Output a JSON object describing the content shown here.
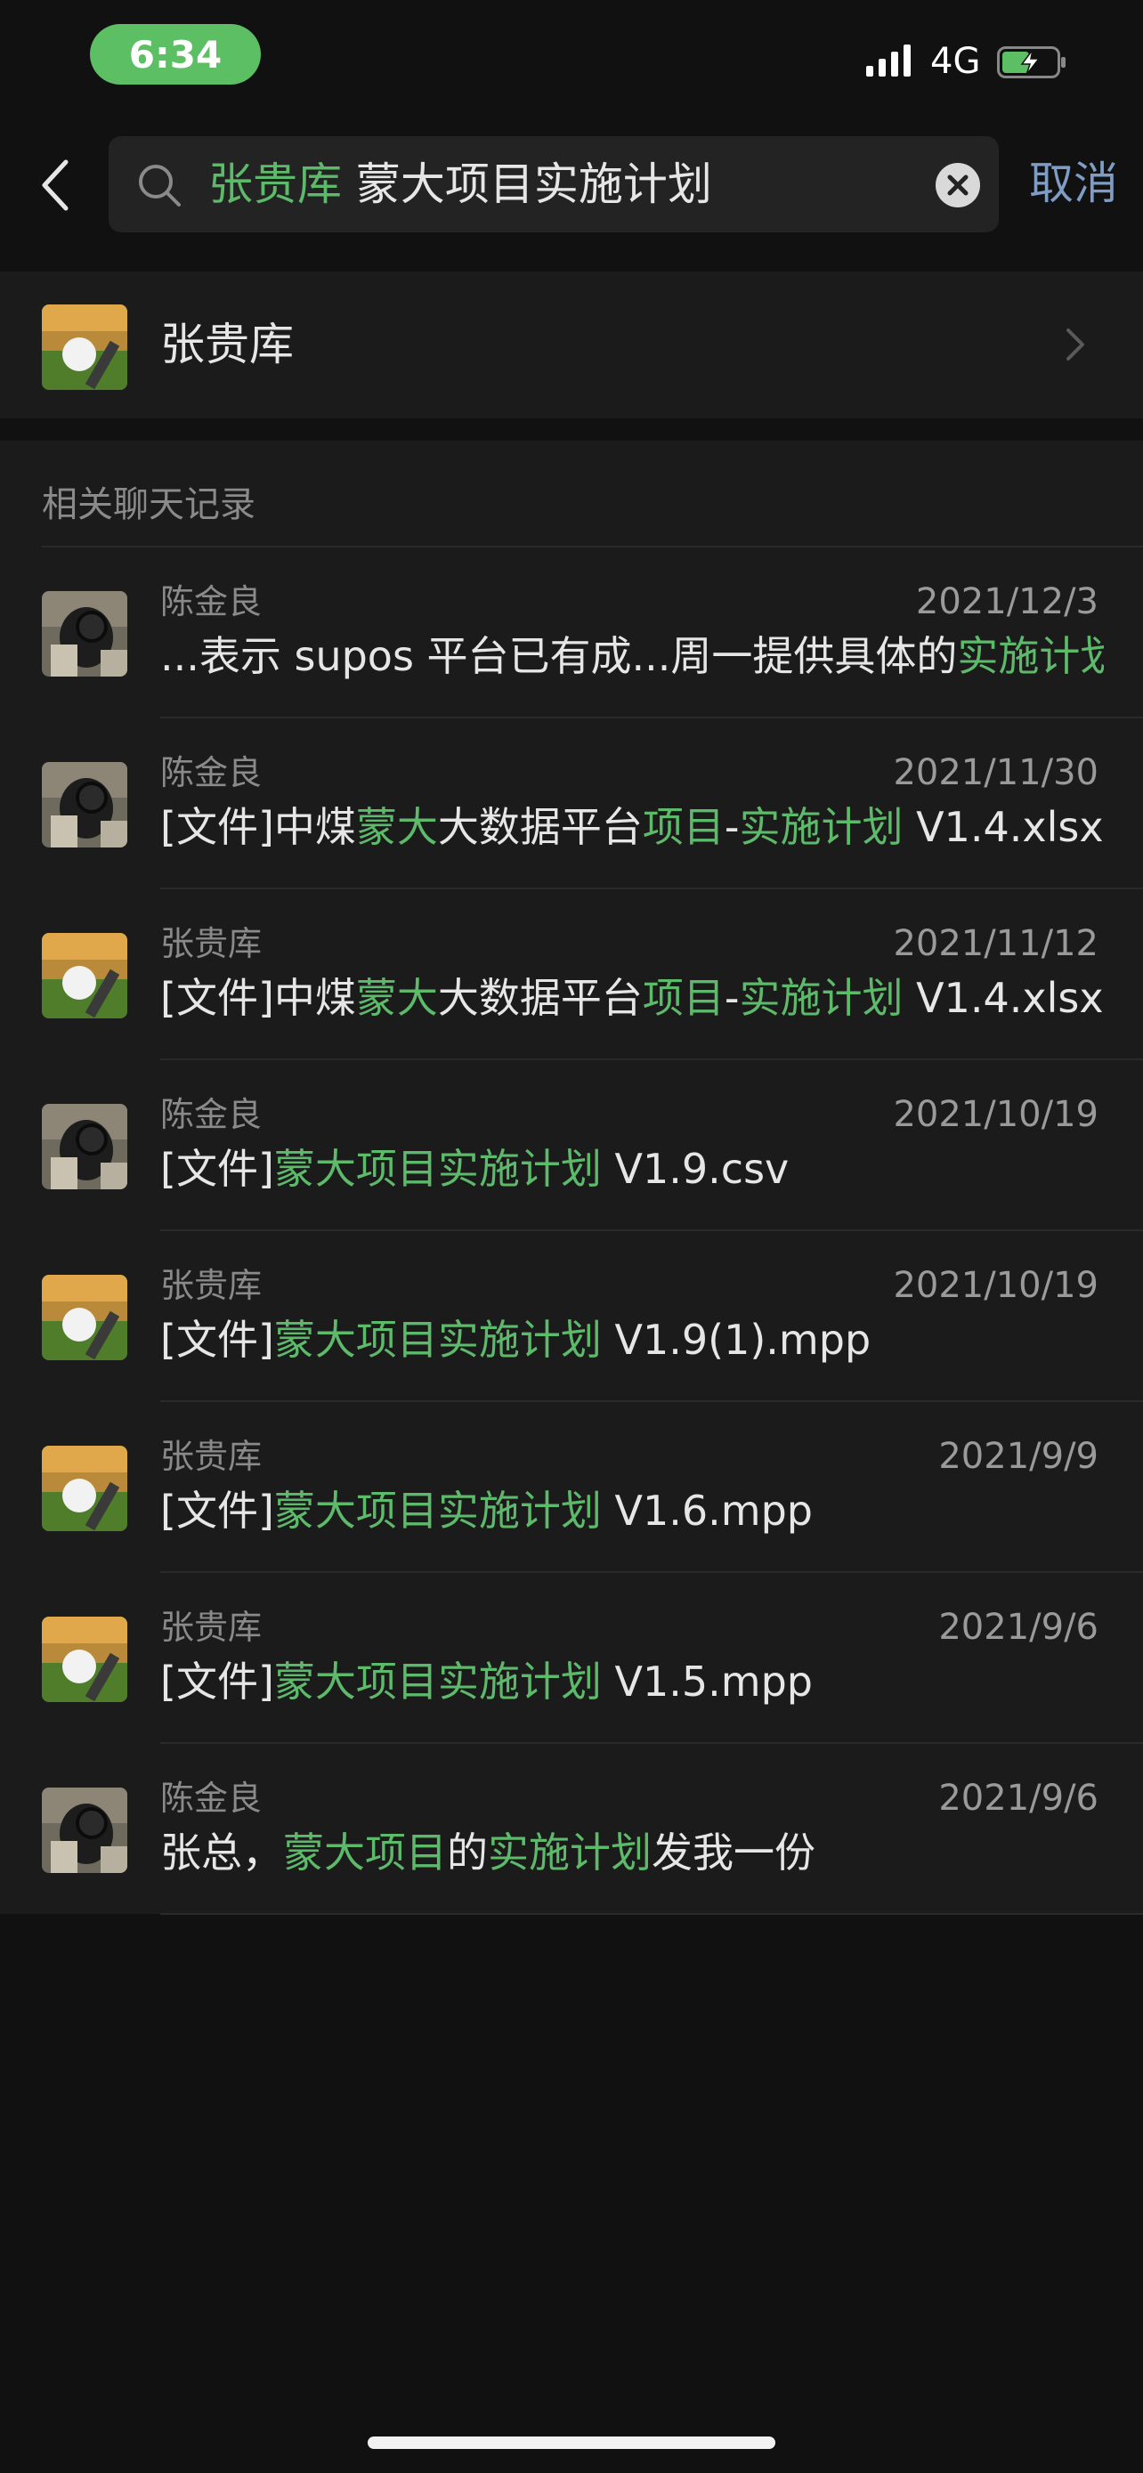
{
  "status_bar": {
    "time": "6:34",
    "network": "4G"
  },
  "search": {
    "query_highlight": "张贵库",
    "query_rest": "蒙大项目实施计划",
    "cancel_label": "取消"
  },
  "contact": {
    "name": "张贵库"
  },
  "related": {
    "title": "相关聊天记录",
    "messages": [
      {
        "sender": "陈金良",
        "date": "2021/12/3",
        "avatar": "camera-avatar",
        "parts": [
          {
            "text": "...表示 supos 平台已有成...周一提供具体的",
            "highlight": false
          },
          {
            "text": "实施计划",
            "highlight": true
          }
        ]
      },
      {
        "sender": "陈金良",
        "date": "2021/11/30",
        "avatar": "camera-avatar",
        "parts": [
          {
            "text": "[文件]中煤",
            "highlight": false
          },
          {
            "text": "蒙大",
            "highlight": true
          },
          {
            "text": "大数据平台",
            "highlight": false
          },
          {
            "text": "项目",
            "highlight": true
          },
          {
            "text": "-",
            "highlight": false
          },
          {
            "text": "实施计划",
            "highlight": true
          },
          {
            "text": " V1.4.xlsx",
            "highlight": false
          }
        ]
      },
      {
        "sender": "张贵库",
        "date": "2021/11/12",
        "avatar": "golf-avatar",
        "parts": [
          {
            "text": "[文件]中煤",
            "highlight": false
          },
          {
            "text": "蒙大",
            "highlight": true
          },
          {
            "text": "大数据平台",
            "highlight": false
          },
          {
            "text": "项目",
            "highlight": true
          },
          {
            "text": "-",
            "highlight": false
          },
          {
            "text": "实施计划",
            "highlight": true
          },
          {
            "text": " V1.4.xlsx",
            "highlight": false
          }
        ]
      },
      {
        "sender": "陈金良",
        "date": "2021/10/19",
        "avatar": "camera-avatar",
        "parts": [
          {
            "text": "[文件]",
            "highlight": false
          },
          {
            "text": "蒙大项目实施计划",
            "highlight": true
          },
          {
            "text": " V1.9.csv",
            "highlight": false
          }
        ]
      },
      {
        "sender": "张贵库",
        "date": "2021/10/19",
        "avatar": "golf-avatar",
        "parts": [
          {
            "text": "[文件]",
            "highlight": false
          },
          {
            "text": "蒙大项目实施计划",
            "highlight": true
          },
          {
            "text": " V1.9(1).mpp",
            "highlight": false
          }
        ]
      },
      {
        "sender": "张贵库",
        "date": "2021/9/9",
        "avatar": "golf-avatar",
        "parts": [
          {
            "text": "[文件]",
            "highlight": false
          },
          {
            "text": "蒙大项目实施计划",
            "highlight": true
          },
          {
            "text": " V1.6.mpp",
            "highlight": false
          }
        ]
      },
      {
        "sender": "张贵库",
        "date": "2021/9/6",
        "avatar": "golf-avatar",
        "parts": [
          {
            "text": "[文件]",
            "highlight": false
          },
          {
            "text": "蒙大项目实施计划",
            "highlight": true
          },
          {
            "text": " V1.5.mpp",
            "highlight": false
          }
        ]
      },
      {
        "sender": "陈金良",
        "date": "2021/9/6",
        "avatar": "camera-avatar",
        "parts": [
          {
            "text": "张总，",
            "highlight": false
          },
          {
            "text": "蒙大项目",
            "highlight": true
          },
          {
            "text": "的",
            "highlight": false
          },
          {
            "text": "实施计划",
            "highlight": true
          },
          {
            "text": "发我一份",
            "highlight": false
          }
        ]
      }
    ]
  },
  "colors": {
    "highlight": "#5dba6a",
    "cancel": "#7f9cc4",
    "time_pill": "#5cbf63"
  }
}
